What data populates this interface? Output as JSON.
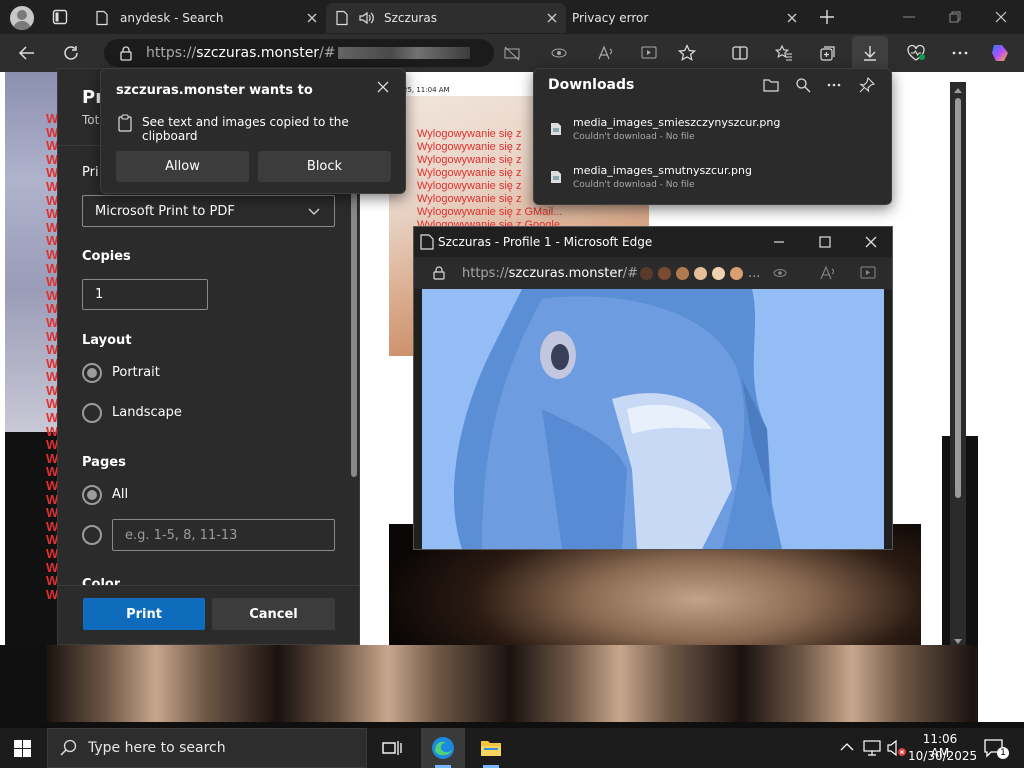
{
  "tabs": [
    {
      "title": "anydesk - Search",
      "icon": "search-page-icon"
    },
    {
      "title": "Szczuras",
      "icon": "page-icon",
      "audio": "speaker-icon"
    },
    {
      "title": "Privacy error",
      "icon": "warning-icon"
    }
  ],
  "address_bar": {
    "url_scheme": "https://",
    "url_host": "szczuras.monster",
    "url_rest": "/#"
  },
  "print_dialog": {
    "title_fragment": "Pr",
    "subtitle_fragment": "Tot",
    "printer_label_fragment": "Pri",
    "printer_value": "Microsoft Print to PDF",
    "copies_label": "Copies",
    "copies_value": "1",
    "layout_label": "Layout",
    "layout_options": [
      "Portrait",
      "Landscape"
    ],
    "pages_label": "Pages",
    "pages_all": "All",
    "pages_placeholder": "e.g. 1-5, 8, 11-13",
    "color_label_fragment": "Color",
    "print_button": "Print",
    "cancel_button": "Cancel",
    "accent_color": "#0f6cbd"
  },
  "permission_popup": {
    "title": "szczuras.monster wants to",
    "request": "See text and images copied to the clipboard",
    "allow": "Allow",
    "block": "Block"
  },
  "downloads": {
    "title": "Downloads",
    "items": [
      {
        "name": "media_images_smieszczynyszcur.png",
        "status": "Couldn't download - No file"
      },
      {
        "name": "media_images_smutnyszcur.png",
        "status": "Couldn't download - No file"
      }
    ]
  },
  "page": {
    "timestamp_fragment": "25, 11:04 AM",
    "logout_lines": [
      "Wylogowywanie się z",
      "Wylogowywanie się z",
      "Wylogowywanie się z",
      "Wylogowywanie się z",
      "Wylogowywanie się z",
      "Wylogowywanie się z",
      "Wylogowywanie się z GMail...",
      "Wylogowywanie się z Google"
    ],
    "side_letter": "W"
  },
  "popup_window": {
    "title": "Szczuras - Profile 1 - Microsoft Edge",
    "url_scheme": "https://",
    "url_host": "szczuras.monster",
    "url_rest": "/#",
    "url_suffix": "..."
  },
  "taskbar": {
    "search_placeholder": "Type here to search",
    "time": "11:06 AM",
    "date": "10/30/2025",
    "notification_count": "1"
  }
}
